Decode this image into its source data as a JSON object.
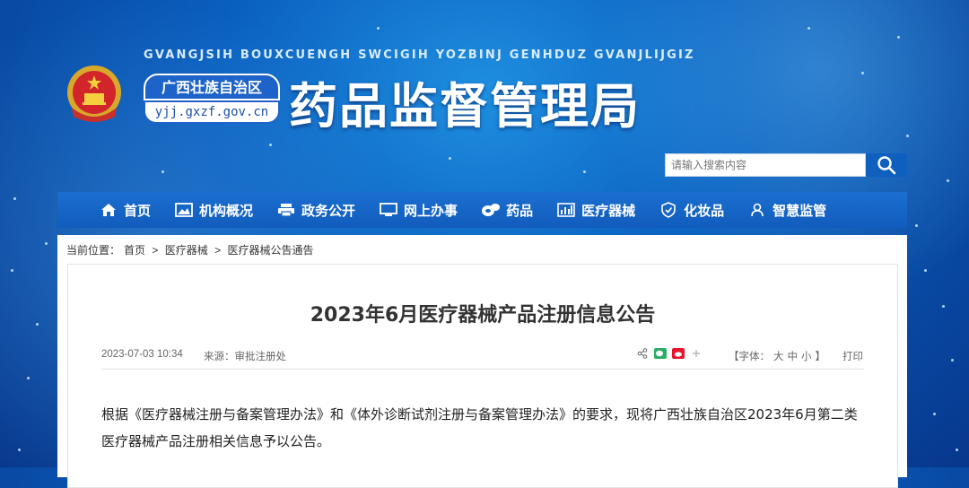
{
  "header": {
    "pinyin": "GVANGJSIH BOUXCUENGH SWCIGIH YOZBINJ GENHDUZ GVANJLIJGIZ",
    "region": "广西壮族自治区",
    "domain": "yjj.gxzf.gov.cn",
    "title": "药品监督管理局"
  },
  "search": {
    "placeholder": "请输入搜索内容",
    "button_icon": "search-icon"
  },
  "nav": {
    "items": [
      {
        "label": "首页",
        "icon": "home-icon"
      },
      {
        "label": "机构概况",
        "icon": "image-icon"
      },
      {
        "label": "政务公开",
        "icon": "printer-icon"
      },
      {
        "label": "网上办事",
        "icon": "monitor-icon"
      },
      {
        "label": "药品",
        "icon": "pill-icon"
      },
      {
        "label": "医疗器械",
        "icon": "bar-chart-icon"
      },
      {
        "label": "化妆品",
        "icon": "shield-icon"
      },
      {
        "label": "智慧监管",
        "icon": "user-icon"
      }
    ]
  },
  "breadcrumb": {
    "prefix": "当前位置：",
    "items": [
      "首页",
      "医疗器械",
      "医疗器械公告通告"
    ],
    "separator": ">"
  },
  "article": {
    "title": "2023年6月医疗器械产品注册信息公告",
    "date": "2023-07-03 10:34",
    "source_label": "来源：",
    "source": "审批注册处",
    "font_label": "【字体：",
    "font_large": "大",
    "font_medium": "中",
    "font_small": "小",
    "font_close": "】",
    "print": "打印",
    "body": "根据《医疗器械注册与备案管理办法》和《体外诊断试剂注册与备案管理办法》的要求，现将广西壮族自治区2023年6月第二类医疗器械产品注册相关信息予以公告。"
  },
  "colors": {
    "nav_bg": "#1465c4",
    "accent": "#0f5fbf"
  }
}
